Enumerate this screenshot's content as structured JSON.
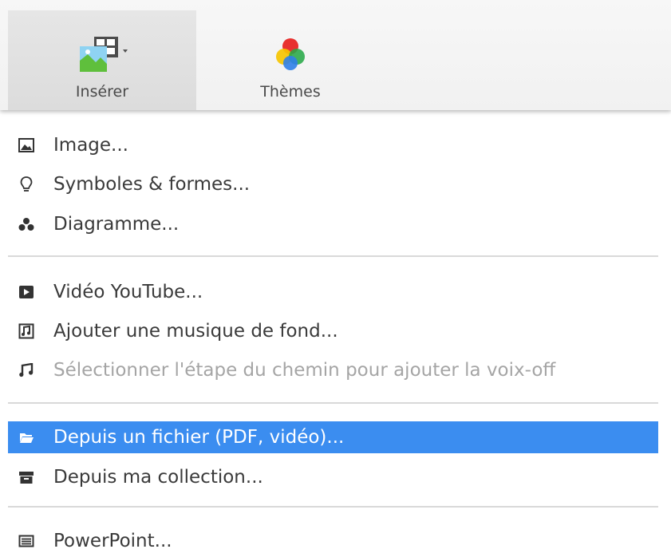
{
  "toolbar": {
    "insert_label": "Insérer",
    "themes_label": "Thèmes"
  },
  "menu": {
    "group1": [
      {
        "label": "Image...",
        "icon": "image-icon"
      },
      {
        "label": "Symboles & formes...",
        "icon": "lightbulb-icon"
      },
      {
        "label": "Diagramme...",
        "icon": "diagram-icon"
      }
    ],
    "group2": [
      {
        "label": "Vidéo YouTube...",
        "icon": "play-icon"
      },
      {
        "label": "Ajouter une musique de fond...",
        "icon": "music-file-icon"
      },
      {
        "label": "Sélectionner l'étape du chemin pour ajouter la voix-off",
        "icon": "music-note-icon",
        "disabled": true
      }
    ],
    "group3": [
      {
        "label": "Depuis un fichier (PDF, vidéo)...",
        "icon": "folder-open-icon",
        "highlighted": true
      },
      {
        "label": "Depuis ma collection...",
        "icon": "archive-icon"
      }
    ],
    "group4": [
      {
        "label": "PowerPoint...",
        "icon": "powerpoint-icon"
      }
    ]
  },
  "colors": {
    "highlight": "#3b8df0",
    "disabled_text": "#a5a5a5",
    "text": "#3a3a3a"
  }
}
